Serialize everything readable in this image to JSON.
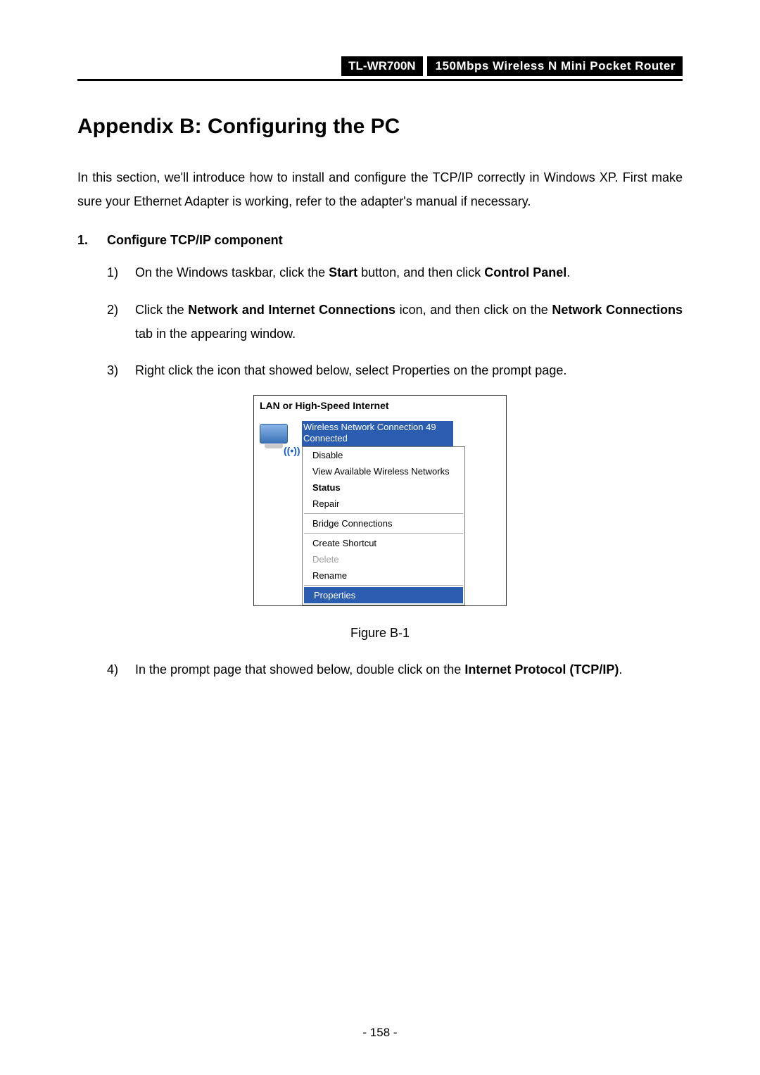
{
  "header": {
    "model": "TL-WR700N",
    "product": "150Mbps Wireless N Mini Pocket Router"
  },
  "title": "Appendix B: Configuring the PC",
  "intro": "In this section, we'll introduce how to install and configure the TCP/IP correctly in Windows XP. First make sure your Ethernet Adapter is working, refer to the adapter's manual if necessary.",
  "section1": {
    "num": "1.",
    "title": "Configure TCP/IP component"
  },
  "steps": {
    "s1": {
      "num": "1)",
      "pre": "On the Windows taskbar, click the ",
      "b1": "Start",
      "mid": " button, and then click ",
      "b2": "Control Panel",
      "post": "."
    },
    "s2": {
      "num": "2)",
      "pre": "Click the ",
      "b1": "Network and Internet Connections",
      "mid": " icon, and then click on the ",
      "b2": "Network Connections",
      "post": " tab in the appearing window."
    },
    "s3": {
      "num": "3)",
      "text": "Right click the icon that showed below, select Properties on the prompt page."
    },
    "s4": {
      "num": "4)",
      "pre": "In the prompt page that showed below, double click on the ",
      "b1": "Internet Protocol (TCP/IP)",
      "post": "."
    }
  },
  "figure": {
    "section_title": "LAN or High-Speed Internet",
    "conn_name": "Wireless Network Connection 49",
    "conn_status": "Connected",
    "menu": {
      "disable": "Disable",
      "view": "View Available Wireless Networks",
      "status": "Status",
      "repair": "Repair",
      "bridge": "Bridge Connections",
      "shortcut": "Create Shortcut",
      "delete": "Delete",
      "rename": "Rename",
      "properties": "Properties"
    },
    "caption": "Figure B-1"
  },
  "page_number": "- 158 -"
}
